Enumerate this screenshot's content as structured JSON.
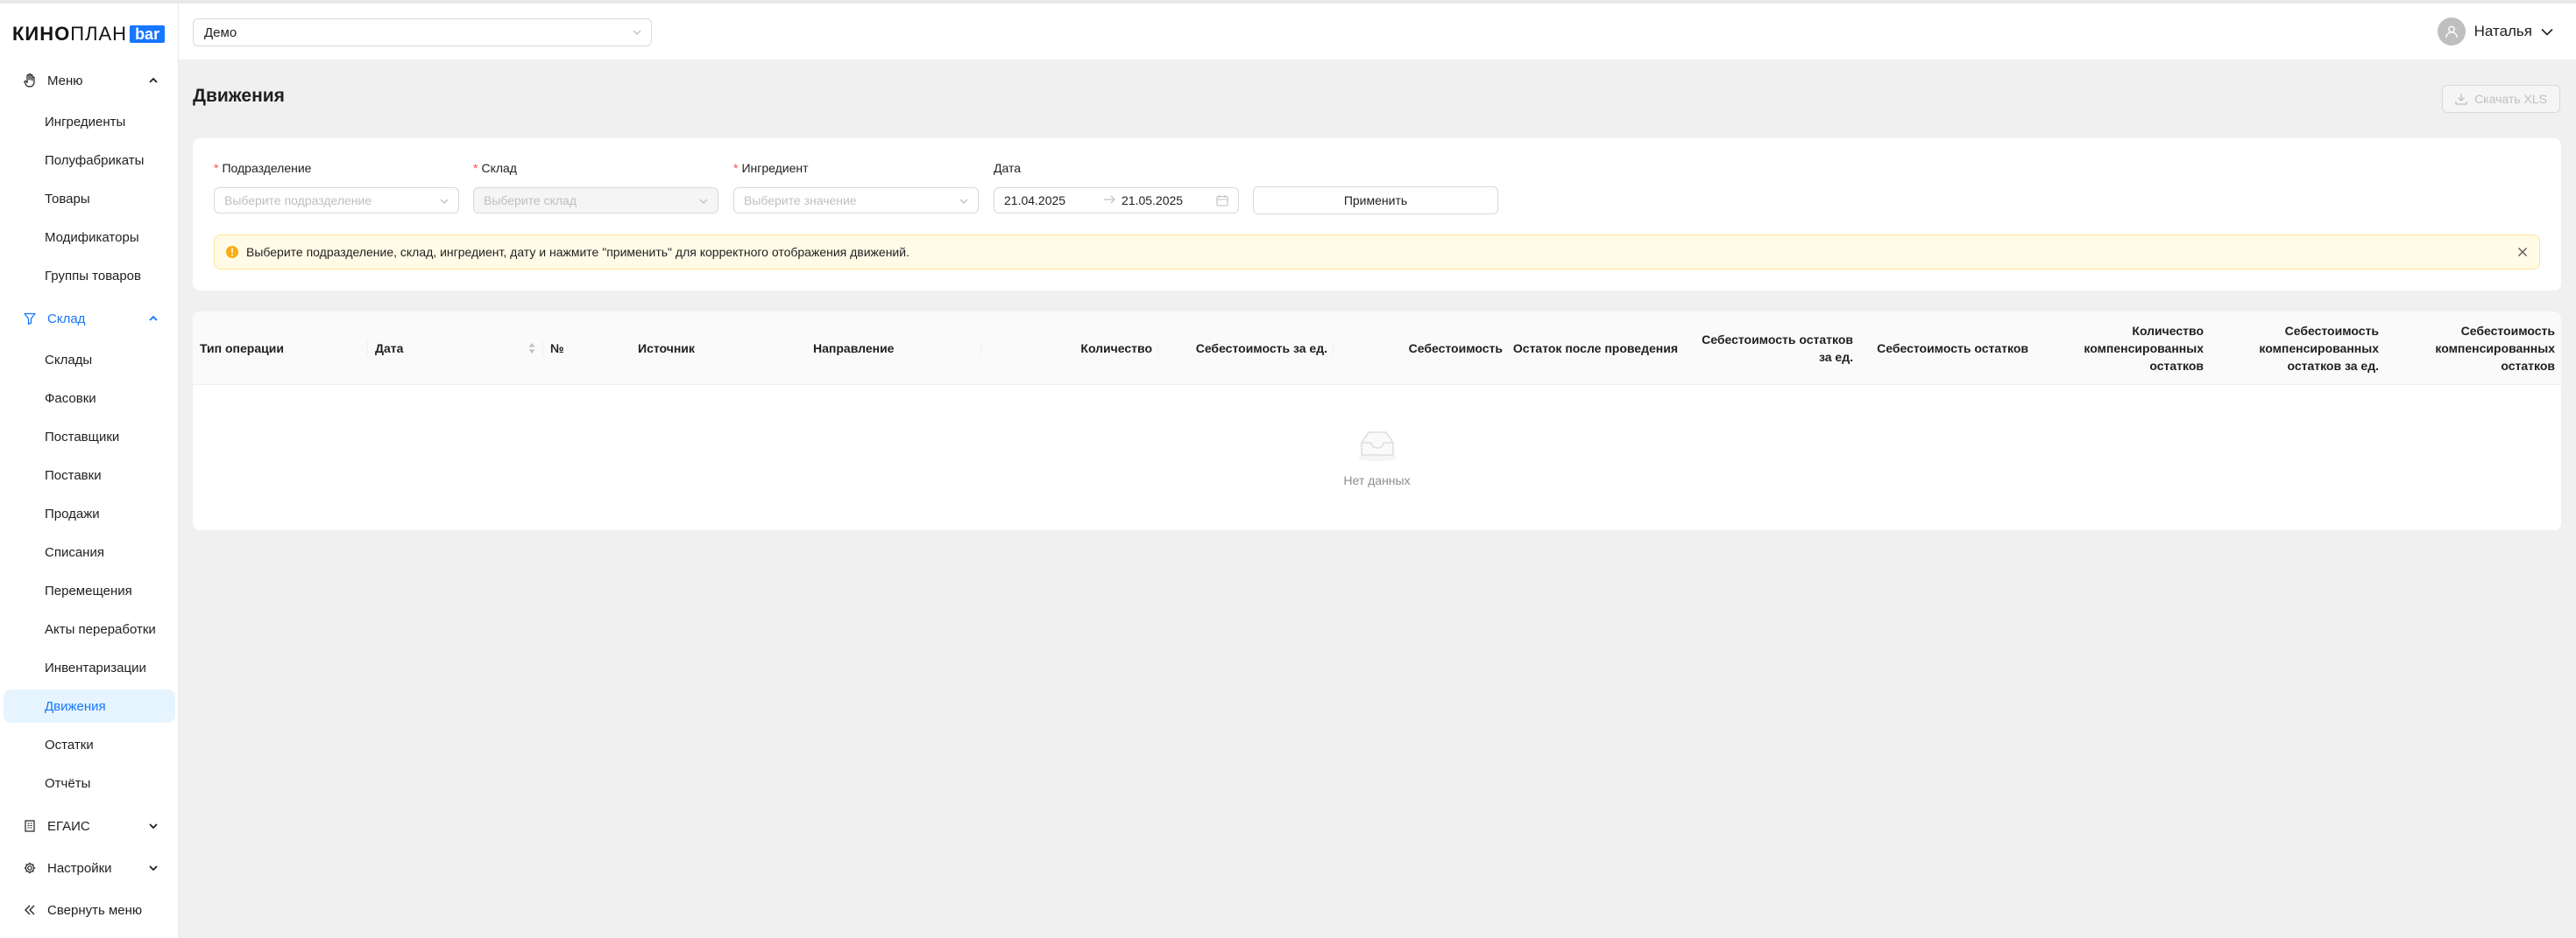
{
  "logo": {
    "bold": "КИНО",
    "thin": "ПЛАН",
    "badge": "bar"
  },
  "header": {
    "location_select": "Демо",
    "user_name": "Наталья"
  },
  "sidebar": {
    "groups": [
      {
        "label": "Меню",
        "icon": "hand-icon",
        "expanded": true,
        "active": false,
        "items": [
          "Ингредиенты",
          "Полуфабрикаты",
          "Товары",
          "Модификаторы",
          "Группы товаров"
        ]
      },
      {
        "label": "Склад",
        "icon": "funnel-icon",
        "expanded": true,
        "active": true,
        "items": [
          "Склады",
          "Фасовки",
          "Поставщики",
          "Поставки",
          "Продажи",
          "Списания",
          "Перемещения",
          "Акты переработки",
          "Инвентаризации",
          "Движения",
          "Остатки",
          "Отчёты"
        ]
      },
      {
        "label": "ЕГАИС",
        "icon": "building-icon",
        "expanded": false,
        "active": false
      },
      {
        "label": "Настройки",
        "icon": "gear-icon",
        "expanded": false,
        "active": false
      }
    ],
    "selected_item": "Движения",
    "collapse_label": "Свернуть меню"
  },
  "page": {
    "title": "Движения",
    "download_label": "Скачать XLS"
  },
  "filters": {
    "division": {
      "label": "Подразделение",
      "required": true,
      "placeholder": "Выберите подразделение"
    },
    "warehouse": {
      "label": "Склад",
      "required": true,
      "placeholder": "Выберите склад",
      "disabled": true
    },
    "ingredient": {
      "label": "Ингредиент",
      "required": true,
      "placeholder": "Выберите значение"
    },
    "date": {
      "label": "Дата",
      "from": "21.04.2025",
      "to": "21.05.2025"
    },
    "apply_label": "Применить"
  },
  "alert": {
    "text": "Выберите подразделение, склад, ингредиент, дату и нажмите \"применить\" для корректного отображения движений."
  },
  "table": {
    "columns": [
      "Тип операции",
      "Дата",
      "№",
      "Источник",
      "Направление",
      "Количество",
      "Себестоимость за ед.",
      "Себестоимость",
      "Остаток после проведения",
      "Себестоимость остатков за ед.",
      "Себестоимость остатков",
      "Количество компенсированных остатков",
      "Себестоимость компенсированных остатков за ед.",
      "Себестоимость компенсированных остатков"
    ],
    "empty_text": "Нет данных"
  },
  "colors": {
    "accent": "#1677ff",
    "selected_bg": "#e6f4ff",
    "warning": "#faad14",
    "alert_bg": "#fffbe6"
  }
}
